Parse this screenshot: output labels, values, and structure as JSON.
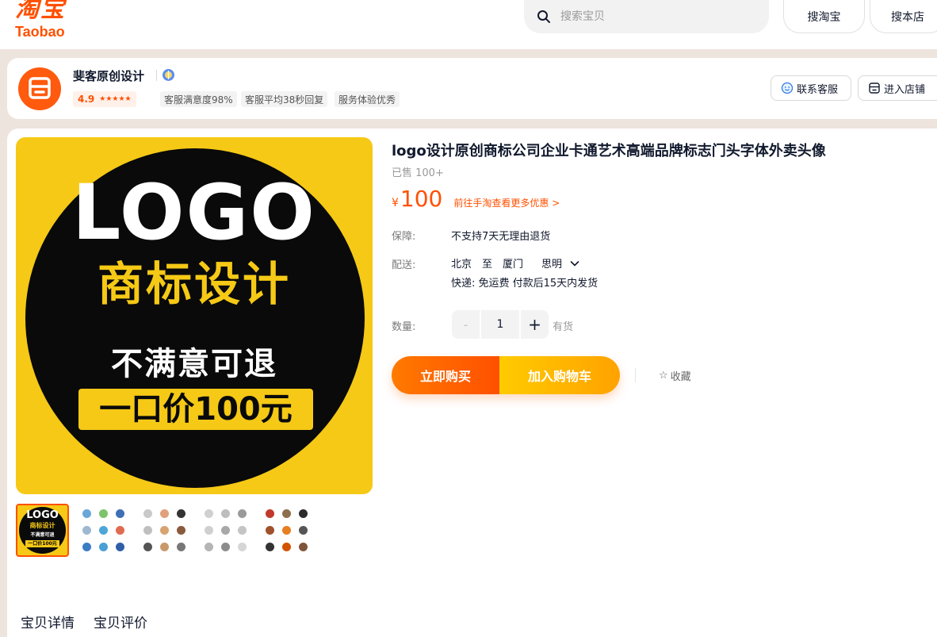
{
  "header": {
    "logo_cn": "淘宝",
    "logo_en": "Taobao",
    "search_placeholder": "搜索宝贝",
    "search_taobao_label": "搜淘宝",
    "search_shop_label": "搜本店"
  },
  "shop": {
    "name": "斐客原创设计",
    "rating": "4.9",
    "stars": "★★★★★",
    "tags": [
      "客服满意度98%",
      "客服平均38秒回复",
      "服务体验优秀"
    ],
    "contact_label": "联系客服",
    "enter_label": "进入店铺",
    "brand_color": "#ff5000"
  },
  "gallery": {
    "main": {
      "headline": "LOGO",
      "subline": "商标设计",
      "promise": "不满意可退",
      "price_tag": "一口价100元"
    },
    "thumb_labels": {
      "t1": "LOGO",
      "t2": "商标设计",
      "t3": "不满意可退",
      "t4": "一口价100元"
    }
  },
  "product": {
    "title": "logo设计原创商标公司企业卡通艺术高端品牌标志门头字体外卖头像",
    "sold": "已售 100+",
    "currency": "¥",
    "price": "100",
    "promo_link": "前往手淘查看更多优惠 >",
    "guarantee_label": "保障:",
    "guarantee_value": "不支持7天无理由退货",
    "delivery_label": "配送:",
    "delivery_from": "北京",
    "delivery_to_word": "至",
    "delivery_city": "厦门",
    "delivery_district": "思明",
    "shipping_info": "快递: 免运费  付款后15天内发货",
    "quantity_label": "数量:",
    "quantity": "1",
    "stock": "有货",
    "buy_now_label": "立即购买",
    "add_cart_label": "加入购物车",
    "favorite_label": "收藏"
  },
  "detail_tabs": [
    "宝贝详情",
    "宝贝评价"
  ]
}
